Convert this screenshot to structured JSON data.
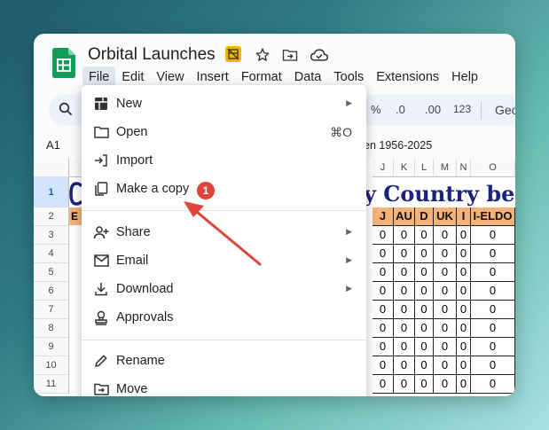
{
  "app": {
    "doc_title": "Orbital Launches"
  },
  "title_icons": [
    "sheet-settings-icon",
    "star-icon",
    "move-to-folder-icon",
    "cloud-status-icon"
  ],
  "menubar": [
    "File",
    "Edit",
    "View",
    "Insert",
    "Format",
    "Data",
    "Tools",
    "Extensions",
    "Help"
  ],
  "toolbar": {
    "percent": "%",
    "dec_decrease": ".0",
    "dec_increase": ".00",
    "number_format": "123",
    "font": "Geo"
  },
  "namebox": "A1",
  "formula_text": "en 1956-2025",
  "sheet": {
    "title_fragment": "y Country bet",
    "left_fragment_row2": "E",
    "columns": [
      "J",
      "K",
      "L",
      "M",
      "N",
      "O"
    ],
    "rows": [
      "1",
      "2",
      "3",
      "4",
      "5",
      "6",
      "7",
      "8",
      "9",
      "10",
      "11"
    ],
    "header_cells": [
      "J",
      "AU",
      "D",
      "UK",
      "I",
      "I-ELDO"
    ],
    "cell_value": "0"
  },
  "file_menu": {
    "items": [
      {
        "label": "New",
        "icon": "new-spreadsheet-icon",
        "submenu": true
      },
      {
        "label": "Open",
        "icon": "folder-open-icon",
        "shortcut": "⌘O"
      },
      {
        "label": "Import",
        "icon": "import-icon"
      },
      {
        "label": "Make a copy",
        "icon": "copy-icon"
      },
      {
        "label": "Share",
        "icon": "share-person-icon",
        "submenu": true
      },
      {
        "label": "Email",
        "icon": "email-icon",
        "submenu": true
      },
      {
        "label": "Download",
        "icon": "download-icon",
        "submenu": true
      },
      {
        "label": "Approvals",
        "icon": "approvals-icon"
      },
      {
        "label": "Rename",
        "icon": "rename-pencil-icon"
      },
      {
        "label": "Move",
        "icon": "move-folder-icon"
      }
    ]
  },
  "annotation": {
    "step": "1",
    "color": "#e0453a"
  },
  "colors": {
    "accent_green": "#0f9d58",
    "header_orange": "#f3b27a",
    "title_blue": "#1a237e"
  }
}
